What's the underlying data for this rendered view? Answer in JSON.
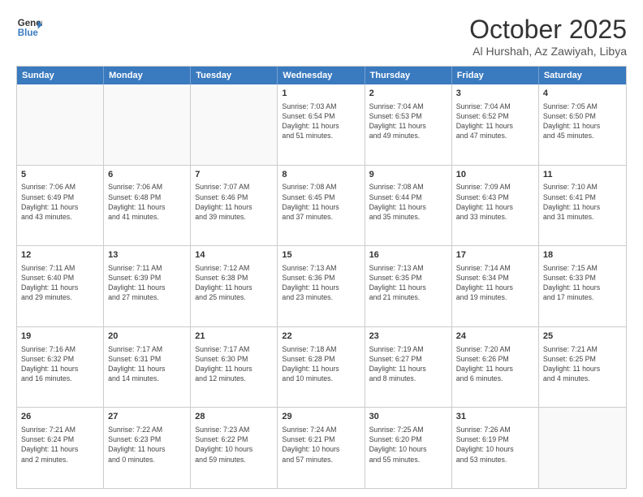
{
  "header": {
    "logo_line1": "General",
    "logo_line2": "Blue",
    "month": "October 2025",
    "location": "Al Hurshah, Az Zawiyah, Libya"
  },
  "weekdays": [
    "Sunday",
    "Monday",
    "Tuesday",
    "Wednesday",
    "Thursday",
    "Friday",
    "Saturday"
  ],
  "weeks": [
    [
      {
        "day": "",
        "info": ""
      },
      {
        "day": "",
        "info": ""
      },
      {
        "day": "",
        "info": ""
      },
      {
        "day": "1",
        "info": "Sunrise: 7:03 AM\nSunset: 6:54 PM\nDaylight: 11 hours\nand 51 minutes."
      },
      {
        "day": "2",
        "info": "Sunrise: 7:04 AM\nSunset: 6:53 PM\nDaylight: 11 hours\nand 49 minutes."
      },
      {
        "day": "3",
        "info": "Sunrise: 7:04 AM\nSunset: 6:52 PM\nDaylight: 11 hours\nand 47 minutes."
      },
      {
        "day": "4",
        "info": "Sunrise: 7:05 AM\nSunset: 6:50 PM\nDaylight: 11 hours\nand 45 minutes."
      }
    ],
    [
      {
        "day": "5",
        "info": "Sunrise: 7:06 AM\nSunset: 6:49 PM\nDaylight: 11 hours\nand 43 minutes."
      },
      {
        "day": "6",
        "info": "Sunrise: 7:06 AM\nSunset: 6:48 PM\nDaylight: 11 hours\nand 41 minutes."
      },
      {
        "day": "7",
        "info": "Sunrise: 7:07 AM\nSunset: 6:46 PM\nDaylight: 11 hours\nand 39 minutes."
      },
      {
        "day": "8",
        "info": "Sunrise: 7:08 AM\nSunset: 6:45 PM\nDaylight: 11 hours\nand 37 minutes."
      },
      {
        "day": "9",
        "info": "Sunrise: 7:08 AM\nSunset: 6:44 PM\nDaylight: 11 hours\nand 35 minutes."
      },
      {
        "day": "10",
        "info": "Sunrise: 7:09 AM\nSunset: 6:43 PM\nDaylight: 11 hours\nand 33 minutes."
      },
      {
        "day": "11",
        "info": "Sunrise: 7:10 AM\nSunset: 6:41 PM\nDaylight: 11 hours\nand 31 minutes."
      }
    ],
    [
      {
        "day": "12",
        "info": "Sunrise: 7:11 AM\nSunset: 6:40 PM\nDaylight: 11 hours\nand 29 minutes."
      },
      {
        "day": "13",
        "info": "Sunrise: 7:11 AM\nSunset: 6:39 PM\nDaylight: 11 hours\nand 27 minutes."
      },
      {
        "day": "14",
        "info": "Sunrise: 7:12 AM\nSunset: 6:38 PM\nDaylight: 11 hours\nand 25 minutes."
      },
      {
        "day": "15",
        "info": "Sunrise: 7:13 AM\nSunset: 6:36 PM\nDaylight: 11 hours\nand 23 minutes."
      },
      {
        "day": "16",
        "info": "Sunrise: 7:13 AM\nSunset: 6:35 PM\nDaylight: 11 hours\nand 21 minutes."
      },
      {
        "day": "17",
        "info": "Sunrise: 7:14 AM\nSunset: 6:34 PM\nDaylight: 11 hours\nand 19 minutes."
      },
      {
        "day": "18",
        "info": "Sunrise: 7:15 AM\nSunset: 6:33 PM\nDaylight: 11 hours\nand 17 minutes."
      }
    ],
    [
      {
        "day": "19",
        "info": "Sunrise: 7:16 AM\nSunset: 6:32 PM\nDaylight: 11 hours\nand 16 minutes."
      },
      {
        "day": "20",
        "info": "Sunrise: 7:17 AM\nSunset: 6:31 PM\nDaylight: 11 hours\nand 14 minutes."
      },
      {
        "day": "21",
        "info": "Sunrise: 7:17 AM\nSunset: 6:30 PM\nDaylight: 11 hours\nand 12 minutes."
      },
      {
        "day": "22",
        "info": "Sunrise: 7:18 AM\nSunset: 6:28 PM\nDaylight: 11 hours\nand 10 minutes."
      },
      {
        "day": "23",
        "info": "Sunrise: 7:19 AM\nSunset: 6:27 PM\nDaylight: 11 hours\nand 8 minutes."
      },
      {
        "day": "24",
        "info": "Sunrise: 7:20 AM\nSunset: 6:26 PM\nDaylight: 11 hours\nand 6 minutes."
      },
      {
        "day": "25",
        "info": "Sunrise: 7:21 AM\nSunset: 6:25 PM\nDaylight: 11 hours\nand 4 minutes."
      }
    ],
    [
      {
        "day": "26",
        "info": "Sunrise: 7:21 AM\nSunset: 6:24 PM\nDaylight: 11 hours\nand 2 minutes."
      },
      {
        "day": "27",
        "info": "Sunrise: 7:22 AM\nSunset: 6:23 PM\nDaylight: 11 hours\nand 0 minutes."
      },
      {
        "day": "28",
        "info": "Sunrise: 7:23 AM\nSunset: 6:22 PM\nDaylight: 10 hours\nand 59 minutes."
      },
      {
        "day": "29",
        "info": "Sunrise: 7:24 AM\nSunset: 6:21 PM\nDaylight: 10 hours\nand 57 minutes."
      },
      {
        "day": "30",
        "info": "Sunrise: 7:25 AM\nSunset: 6:20 PM\nDaylight: 10 hours\nand 55 minutes."
      },
      {
        "day": "31",
        "info": "Sunrise: 7:26 AM\nSunset: 6:19 PM\nDaylight: 10 hours\nand 53 minutes."
      },
      {
        "day": "",
        "info": ""
      }
    ]
  ]
}
